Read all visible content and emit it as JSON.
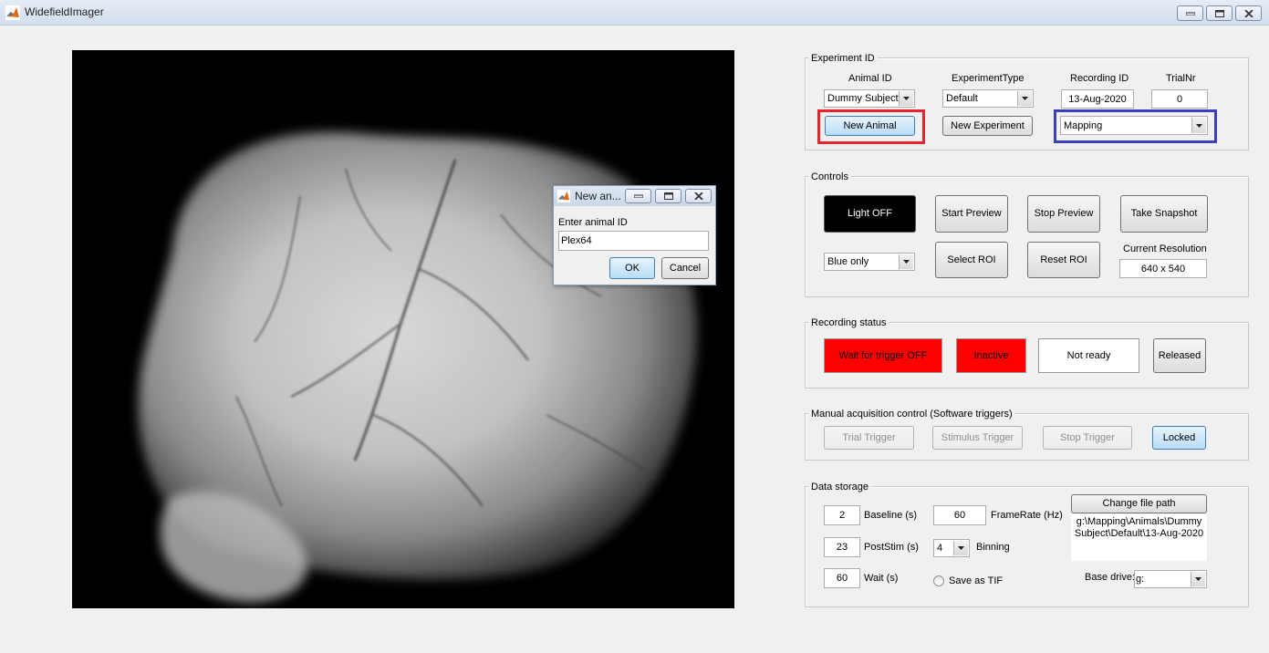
{
  "window": {
    "title": "WidefieldImager",
    "controls": {
      "minimize": "minimize-icon",
      "maximize": "maximize-icon",
      "close": "close-icon"
    }
  },
  "experiment_id": {
    "group_title": "Experiment ID",
    "animal_id_label": "Animal ID",
    "experiment_type_label": "ExperimentType",
    "recording_id_label": "Recording ID",
    "trial_nr_label": "TrialNr",
    "animal_id_value": "Dummy Subject",
    "experiment_type_value": "Default",
    "recording_id_value": "13-Aug-2020",
    "trial_nr_value": "0",
    "new_animal_button": "New Animal",
    "new_experiment_button": "New Experiment",
    "mode_value": "Mapping",
    "highlight_red": "#e8232e",
    "highlight_blue": "#3a3fbd"
  },
  "controls": {
    "group_title": "Controls",
    "light_button": "Light OFF",
    "start_preview_button": "Start Preview",
    "stop_preview_button": "Stop Preview",
    "take_snapshot_button": "Take Snapshot",
    "light_mode_value": "Blue only",
    "select_roi_button": "Select ROI",
    "reset_roi_button": "Reset ROI",
    "current_resolution_label": "Current Resolution",
    "current_resolution_value": "640 x 540"
  },
  "recording_status": {
    "group_title": "Recording status",
    "trigger_status": "Wait for trigger OFF",
    "activity_status": "Inactive",
    "ready_status": "Not ready",
    "release_button": "Released",
    "status_red": "#ff0000"
  },
  "manual_acquisition": {
    "group_title": "Manual acquisition control (Software triggers)",
    "trial_trigger_button": "Trial Trigger",
    "stimulus_trigger_button": "Stimulus Trigger",
    "stop_trigger_button": "Stop Trigger",
    "locked_button": "Locked"
  },
  "data_storage": {
    "group_title": "Data storage",
    "baseline_value": "2",
    "baseline_label": "Baseline (s)",
    "framerate_value": "60",
    "framerate_label": "FrameRate (Hz)",
    "poststim_value": "23",
    "poststim_label": "PostStim (s)",
    "binning_value": "4",
    "binning_label": "Binning",
    "wait_value": "60",
    "wait_label": "Wait (s)",
    "save_as_tif_label": "Save as TIF",
    "change_file_path_button": "Change file path",
    "file_path_line1": "g:\\Mapping\\Animals\\Dummy",
    "file_path_line2": "Subject\\Default\\13-Aug-2020",
    "base_drive_label": "Base drive:",
    "base_drive_value": "g:"
  },
  "dialog": {
    "title": "New an...",
    "prompt": "Enter animal ID",
    "input_value": "Plex64",
    "ok_button": "OK",
    "cancel_button": "Cancel"
  }
}
